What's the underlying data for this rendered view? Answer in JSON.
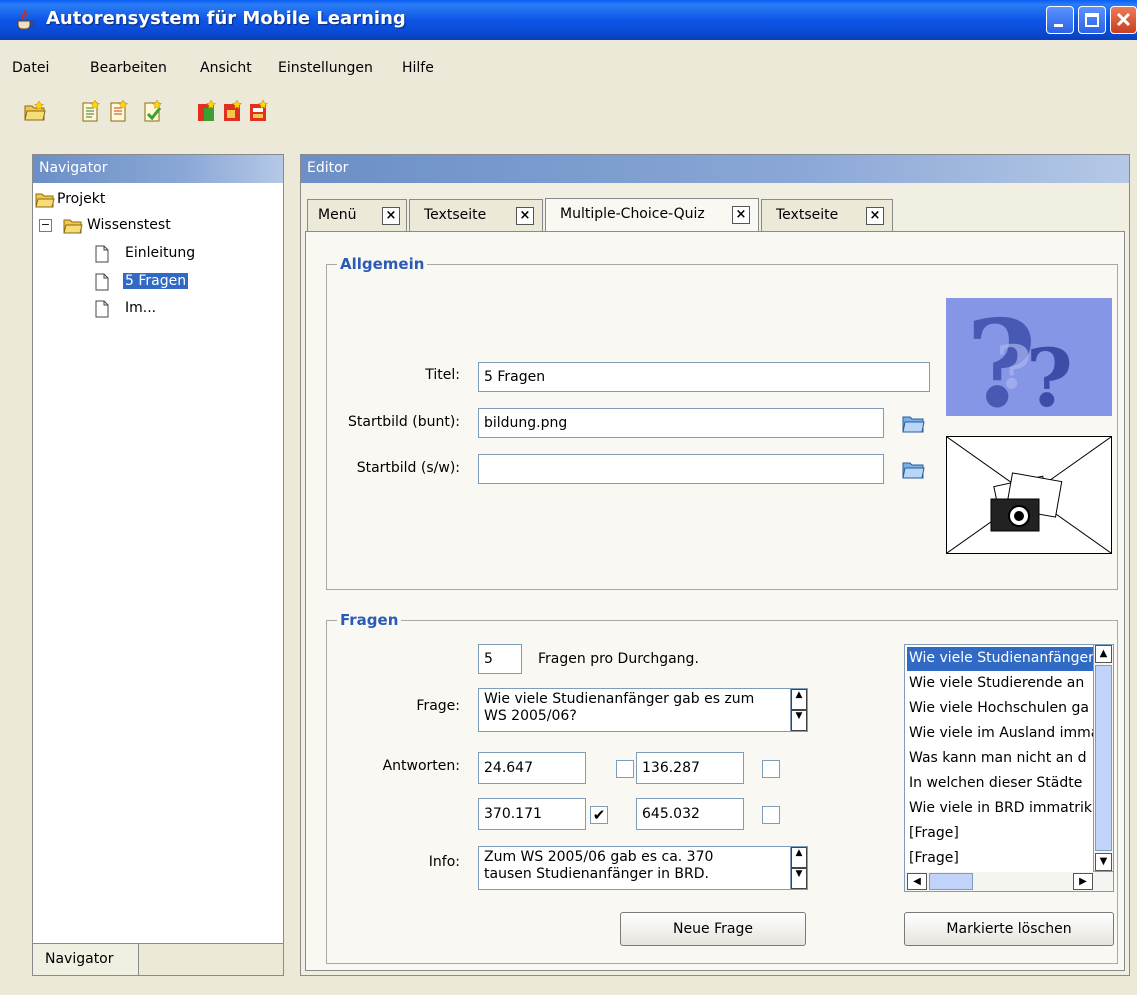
{
  "window": {
    "title": "Autorensystem für Mobile Learning"
  },
  "menu": [
    "Datei",
    "Bearbeiten",
    "Ansicht",
    "Einstellungen",
    "Hilfe"
  ],
  "toolbar_icons": [
    "open-folder-icon",
    "new-page-icon",
    "new-text-page-icon",
    "new-menu-icon",
    "new-quiz-icon",
    "new-image-icon",
    "new-media-icon"
  ],
  "navigator": {
    "title": "Navigator",
    "tab": "Navigator",
    "tree": {
      "root": "Projekt",
      "folder": "Wissenstest",
      "collapse_symbol": "−",
      "items": [
        "Einleitung",
        "5 Fragen",
        "Im..."
      ],
      "selected_index": 1
    }
  },
  "editor": {
    "title": "Editor",
    "close_glyph": "×",
    "tabs": [
      {
        "label": "Menü"
      },
      {
        "label": "Textseite"
      },
      {
        "label": "Multiple-Choice-Quiz"
      },
      {
        "label": "Textseite"
      }
    ],
    "active_tab_index": 2,
    "allgemein": {
      "group_title": "Allgemein",
      "titel_label": "Titel:",
      "titel_value": "5 Fragen",
      "startbild_bunt_label": "Startbild (bunt):",
      "startbild_bunt_value": "bildung.png",
      "startbild_sw_label": "Startbild (s/w):",
      "startbild_sw_value": ""
    },
    "fragen": {
      "group_title": "Fragen",
      "count_value": "5",
      "count_suffix": "Fragen pro Durchgang.",
      "frage_label": "Frage:",
      "frage_value": "Wie viele Studienanfänger gab es zum\nWS 2005/06?",
      "antworten_label": "Antworten:",
      "answers": [
        {
          "value": "24.647",
          "checked": false
        },
        {
          "value": "136.287",
          "checked": false
        },
        {
          "value": "370.171",
          "checked": true
        },
        {
          "value": "645.032",
          "checked": false
        }
      ],
      "check_glyph": "✔",
      "info_label": "Info:",
      "info_value": "Zum WS 2005/06 gab es ca. 370\ntausen Studienanfänger in BRD.",
      "new_button": "Neue Frage",
      "delete_button": "Markierte löschen",
      "question_list": [
        "Wie viele Studienanfänger",
        "Wie viele Studierende an",
        "Wie viele Hochschulen ga",
        "Wie viele im Ausland imma",
        "Was kann man nicht an d",
        "In welchen dieser Städte",
        "Wie viele in BRD immatrik",
        "[Frage]",
        "[Frage]"
      ],
      "selected_question_index": 0
    }
  }
}
